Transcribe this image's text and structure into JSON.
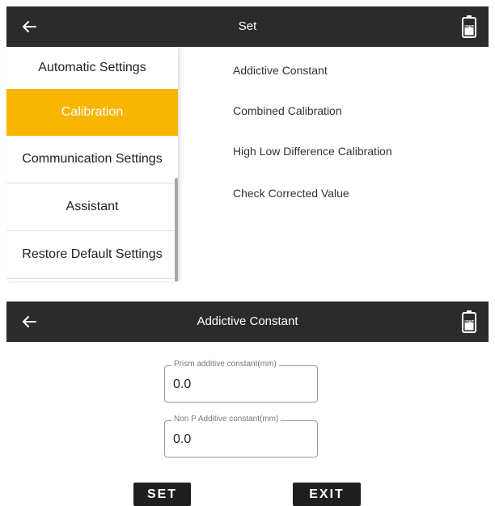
{
  "screen1": {
    "title": "Set",
    "sidebar": {
      "items": [
        {
          "label": "Automatic Settings"
        },
        {
          "label": "Calibration",
          "active": true
        },
        {
          "label": "Communication Settings"
        },
        {
          "label": "Assistant"
        },
        {
          "label": "Restore Default Settings"
        }
      ]
    },
    "menu": {
      "items": [
        {
          "label": "Addictive Constant"
        },
        {
          "label": "Combined Calibration"
        },
        {
          "label": "High Low Difference Calibration"
        },
        {
          "label": "Check Corrected Value"
        }
      ]
    },
    "battery_icon": "battery-icon",
    "battery_text": "60%"
  },
  "screen2": {
    "title": "Addictive Constant",
    "fields": [
      {
        "label": "Prism additive constant(mm)",
        "value": "0.0"
      },
      {
        "label": "Non P Additive constant(mm)",
        "value": "0.0"
      }
    ],
    "buttons": {
      "set_label": "SET",
      "exit_label": "EXIT"
    },
    "battery_icon": "battery-icon",
    "battery_text": "60%"
  },
  "colors": {
    "topbar": "#2b2b2b",
    "accent": "#f7b500",
    "button": "#1f1f1f"
  }
}
